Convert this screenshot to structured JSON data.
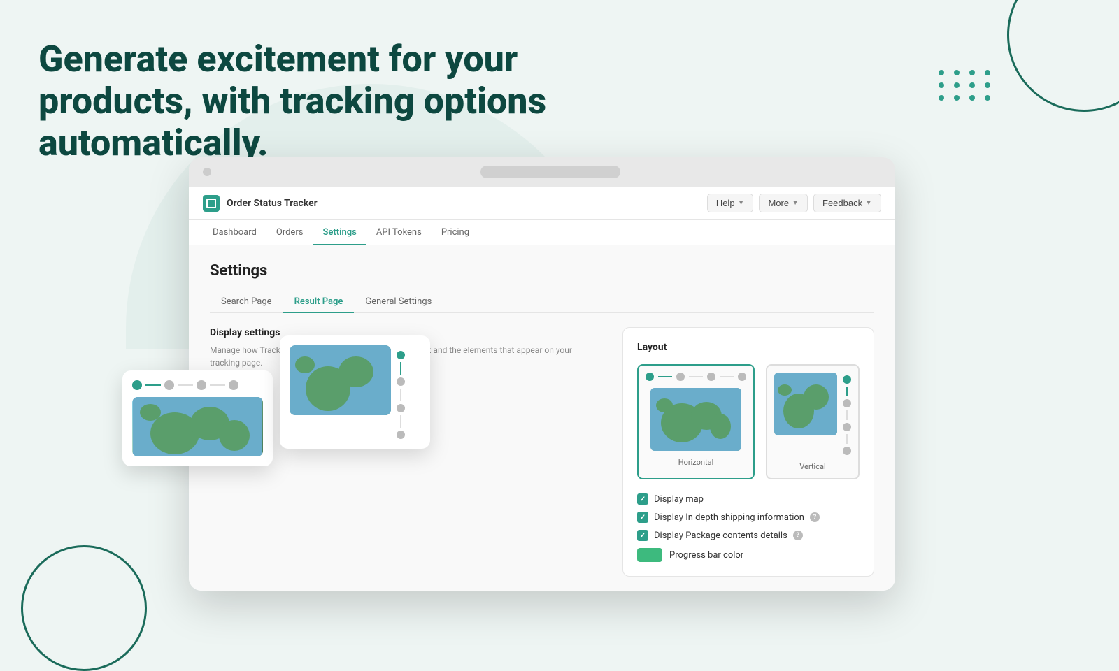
{
  "hero": {
    "title": "Generate excitement for your products, with tracking options automatically."
  },
  "app": {
    "name": "Order Status Tracker",
    "nav_tabs": [
      {
        "label": "Dashboard",
        "active": false
      },
      {
        "label": "Orders",
        "active": false
      },
      {
        "label": "Settings",
        "active": true
      },
      {
        "label": "API Tokens",
        "active": false
      },
      {
        "label": "Pricing",
        "active": false
      }
    ],
    "header_buttons": [
      {
        "label": "Help",
        "has_dropdown": true
      },
      {
        "label": "More",
        "has_dropdown": true
      },
      {
        "label": "Feedback",
        "has_dropdown": true
      }
    ]
  },
  "settings": {
    "title": "Settings",
    "sub_tabs": [
      {
        "label": "Search Page",
        "active": false
      },
      {
        "label": "Result Page",
        "active": true
      },
      {
        "label": "General Settings",
        "active": false
      }
    ],
    "display_settings": {
      "title": "Display settings",
      "description": "Manage how Tracker fits within your existing theme's layout and the elements that appear on your tracking page."
    },
    "layout": {
      "title": "Layout",
      "options": [
        {
          "label": "Horizontal",
          "selected": true
        },
        {
          "label": "Vertical",
          "selected": false
        }
      ]
    },
    "checkboxes": [
      {
        "label": "Display map",
        "checked": true
      },
      {
        "label": "Display In depth shipping information",
        "checked": true,
        "has_info": true
      },
      {
        "label": "Display Package contents details",
        "checked": true,
        "has_info": true
      }
    ],
    "progress_bar_color": {
      "label": "Progress bar color",
      "color": "#3dba7e"
    }
  }
}
